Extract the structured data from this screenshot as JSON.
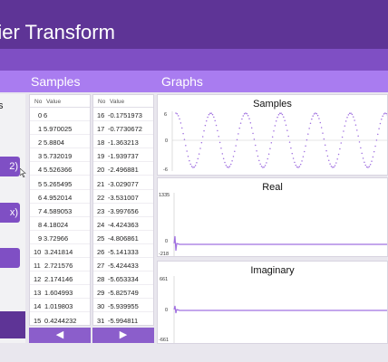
{
  "app": {
    "title": "rier Transform"
  },
  "sections": {
    "samples": "Samples",
    "graphs": "Graphs"
  },
  "left_panel": {
    "cut_label": "s",
    "button_a": "2)",
    "button_b": "x)"
  },
  "table": {
    "col_no": "No",
    "col_value": "Value",
    "left_rows": [
      {
        "no": "0",
        "value": "6"
      },
      {
        "no": "1",
        "value": "5.970025"
      },
      {
        "no": "2",
        "value": "5.8804"
      },
      {
        "no": "3",
        "value": "5.732019"
      },
      {
        "no": "4",
        "value": "5.526366"
      },
      {
        "no": "5",
        "value": "5.265495"
      },
      {
        "no": "6",
        "value": "4.952014"
      },
      {
        "no": "7",
        "value": "4.589053"
      },
      {
        "no": "8",
        "value": "4.18024"
      },
      {
        "no": "9",
        "value": "3.72966"
      },
      {
        "no": "10",
        "value": "3.241814"
      },
      {
        "no": "11",
        "value": "2.721576"
      },
      {
        "no": "12",
        "value": "2.174146"
      },
      {
        "no": "13",
        "value": "1.604993"
      },
      {
        "no": "14",
        "value": "1.019803"
      },
      {
        "no": "15",
        "value": "0.4244232"
      }
    ],
    "right_rows": [
      {
        "no": "16",
        "value": "-0.1751973"
      },
      {
        "no": "17",
        "value": "-0.7730672"
      },
      {
        "no": "18",
        "value": "-1.363213"
      },
      {
        "no": "19",
        "value": "-1.939737"
      },
      {
        "no": "20",
        "value": "-2.496881"
      },
      {
        "no": "21",
        "value": "-3.029077"
      },
      {
        "no": "22",
        "value": "-3.531007"
      },
      {
        "no": "23",
        "value": "-3.997656"
      },
      {
        "no": "24",
        "value": "-4.424363"
      },
      {
        "no": "25",
        "value": "-4.806861"
      },
      {
        "no": "26",
        "value": "-5.141333"
      },
      {
        "no": "27",
        "value": "-5.424433"
      },
      {
        "no": "28",
        "value": "-5.653334"
      },
      {
        "no": "29",
        "value": "-5.825749"
      },
      {
        "no": "30",
        "value": "-5.939955"
      },
      {
        "no": "31",
        "value": "-5.994811"
      }
    ],
    "prev_icon": "◀",
    "next_icon": "▶"
  },
  "graphs": [
    {
      "title": "Samples",
      "ymax": "6",
      "ymid": "0",
      "ymin": "-6"
    },
    {
      "title": "Real",
      "ymax": "1335",
      "ymid": "0",
      "ymin": "-218"
    },
    {
      "title": "Imaginary",
      "ymax": "661",
      "ymid": "0",
      "ymin": "-661"
    }
  ],
  "colors": {
    "title_bar": "#5e3496",
    "sub_bar": "#7f4fc4",
    "section_bar": "#a97cf0",
    "plot": "#a070e0"
  }
}
